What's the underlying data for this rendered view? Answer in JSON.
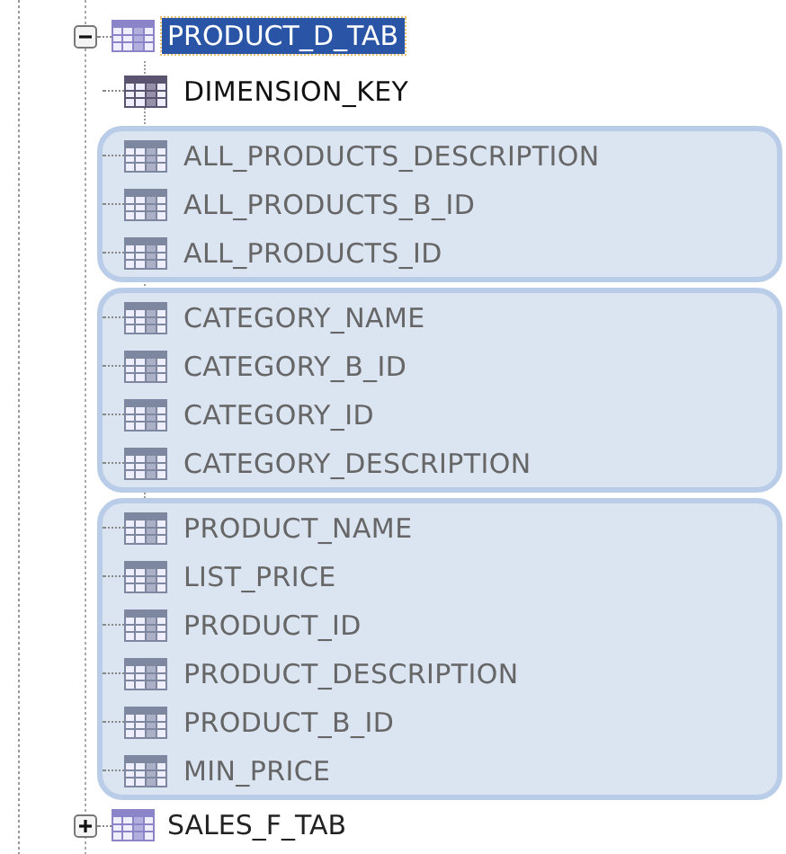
{
  "tree": [
    {
      "label": "PRODUCT_D_TAB",
      "expanded": true,
      "selected": true,
      "groups": [
        {
          "highlighted": false,
          "columns": [
            {
              "label": "DIMENSION_KEY",
              "kind": "key"
            }
          ]
        },
        {
          "highlighted": true,
          "columns": [
            {
              "label": "ALL_PRODUCTS_DESCRIPTION",
              "kind": "column"
            },
            {
              "label": "ALL_PRODUCTS_B_ID",
              "kind": "column"
            },
            {
              "label": "ALL_PRODUCTS_ID",
              "kind": "column"
            }
          ]
        },
        {
          "highlighted": true,
          "columns": [
            {
              "label": "CATEGORY_NAME",
              "kind": "column"
            },
            {
              "label": "CATEGORY_B_ID",
              "kind": "column"
            },
            {
              "label": "CATEGORY_ID",
              "kind": "column"
            },
            {
              "label": "CATEGORY_DESCRIPTION",
              "kind": "column"
            }
          ]
        },
        {
          "highlighted": true,
          "columns": [
            {
              "label": "PRODUCT_NAME",
              "kind": "column"
            },
            {
              "label": "LIST_PRICE",
              "kind": "column"
            },
            {
              "label": "PRODUCT_ID",
              "kind": "column"
            },
            {
              "label": "PRODUCT_DESCRIPTION",
              "kind": "column"
            },
            {
              "label": "PRODUCT_B_ID",
              "kind": "column"
            },
            {
              "label": "MIN_PRICE",
              "kind": "column"
            }
          ]
        }
      ]
    },
    {
      "label": "SALES_F_TAB",
      "expanded": false,
      "selected": false
    }
  ]
}
